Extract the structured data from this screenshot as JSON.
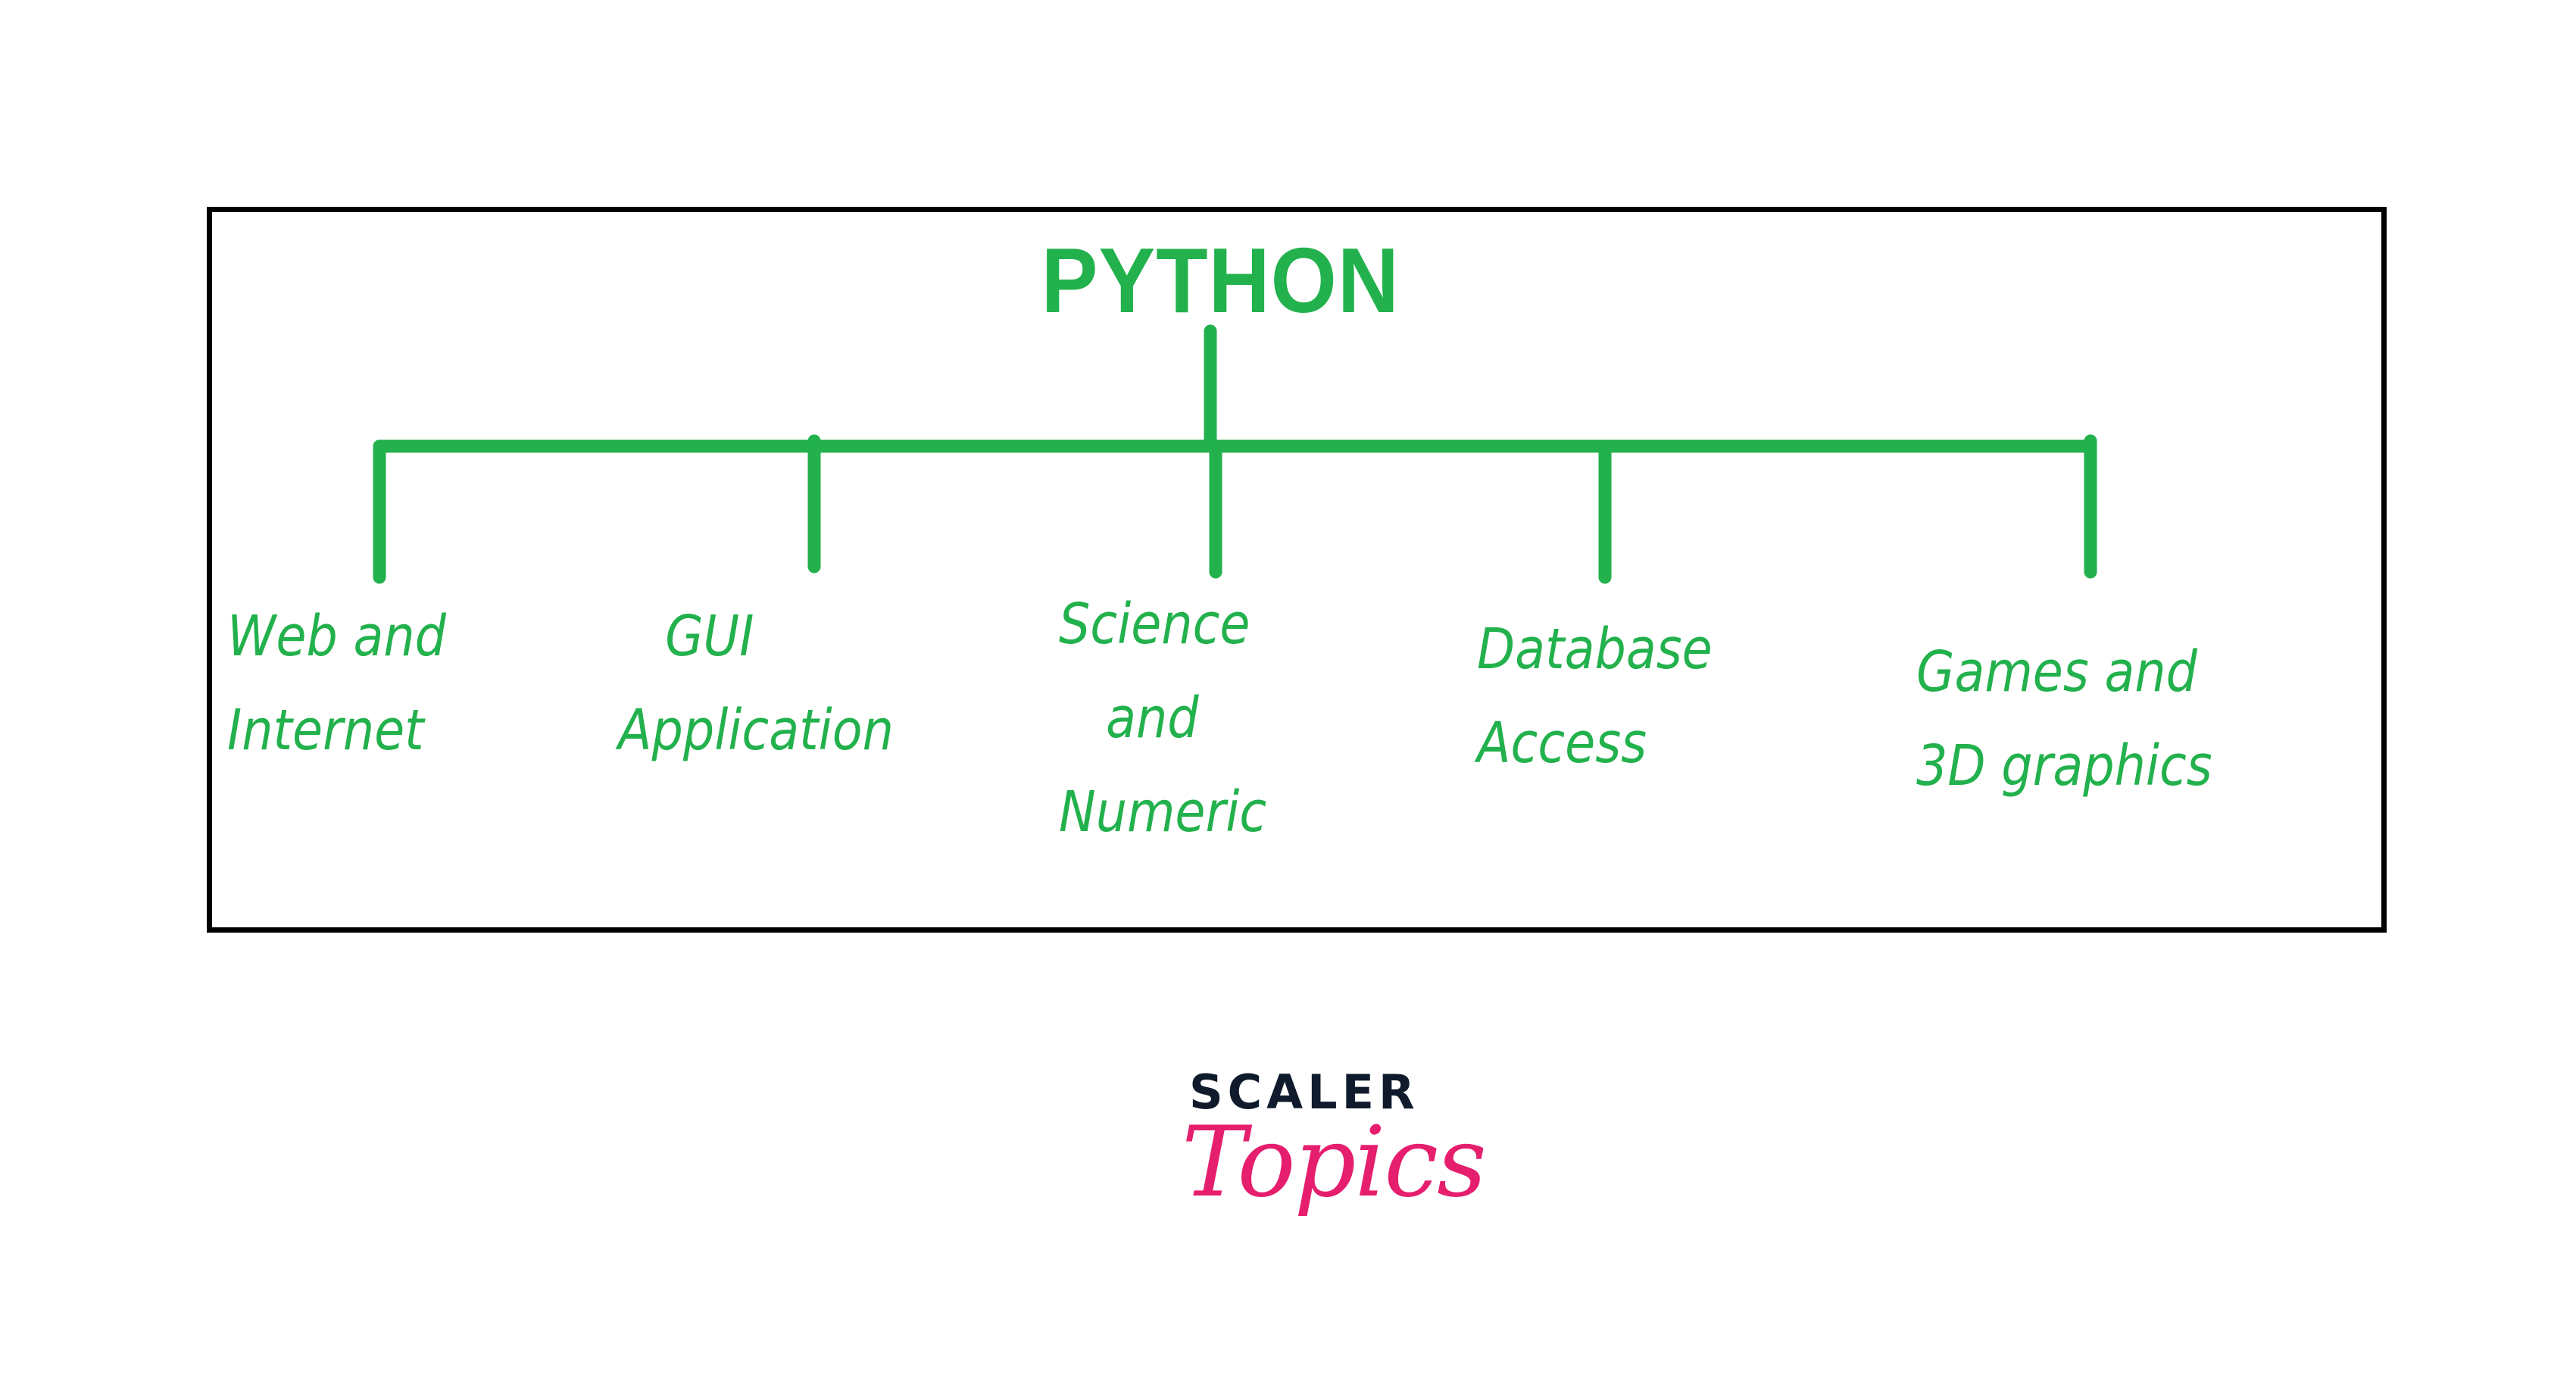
{
  "diagram": {
    "title": "PYTHON",
    "colors": {
      "accent": "#22b14c",
      "frame": "#000000"
    },
    "root": "PYTHON",
    "children": [
      {
        "id": "web",
        "label": "Web and\nInternet"
      },
      {
        "id": "gui",
        "label": "   GUI\nApplication"
      },
      {
        "id": "science",
        "label": "Science\n   and\nNumeric"
      },
      {
        "id": "database",
        "label": "Database\nAccess"
      },
      {
        "id": "games",
        "label": "Games and\n3D graphics"
      }
    ]
  },
  "logo": {
    "brand": "SCALER",
    "product": "Topics",
    "colors": {
      "brand": "#0f1a2c",
      "product": "#e61e6e"
    }
  }
}
